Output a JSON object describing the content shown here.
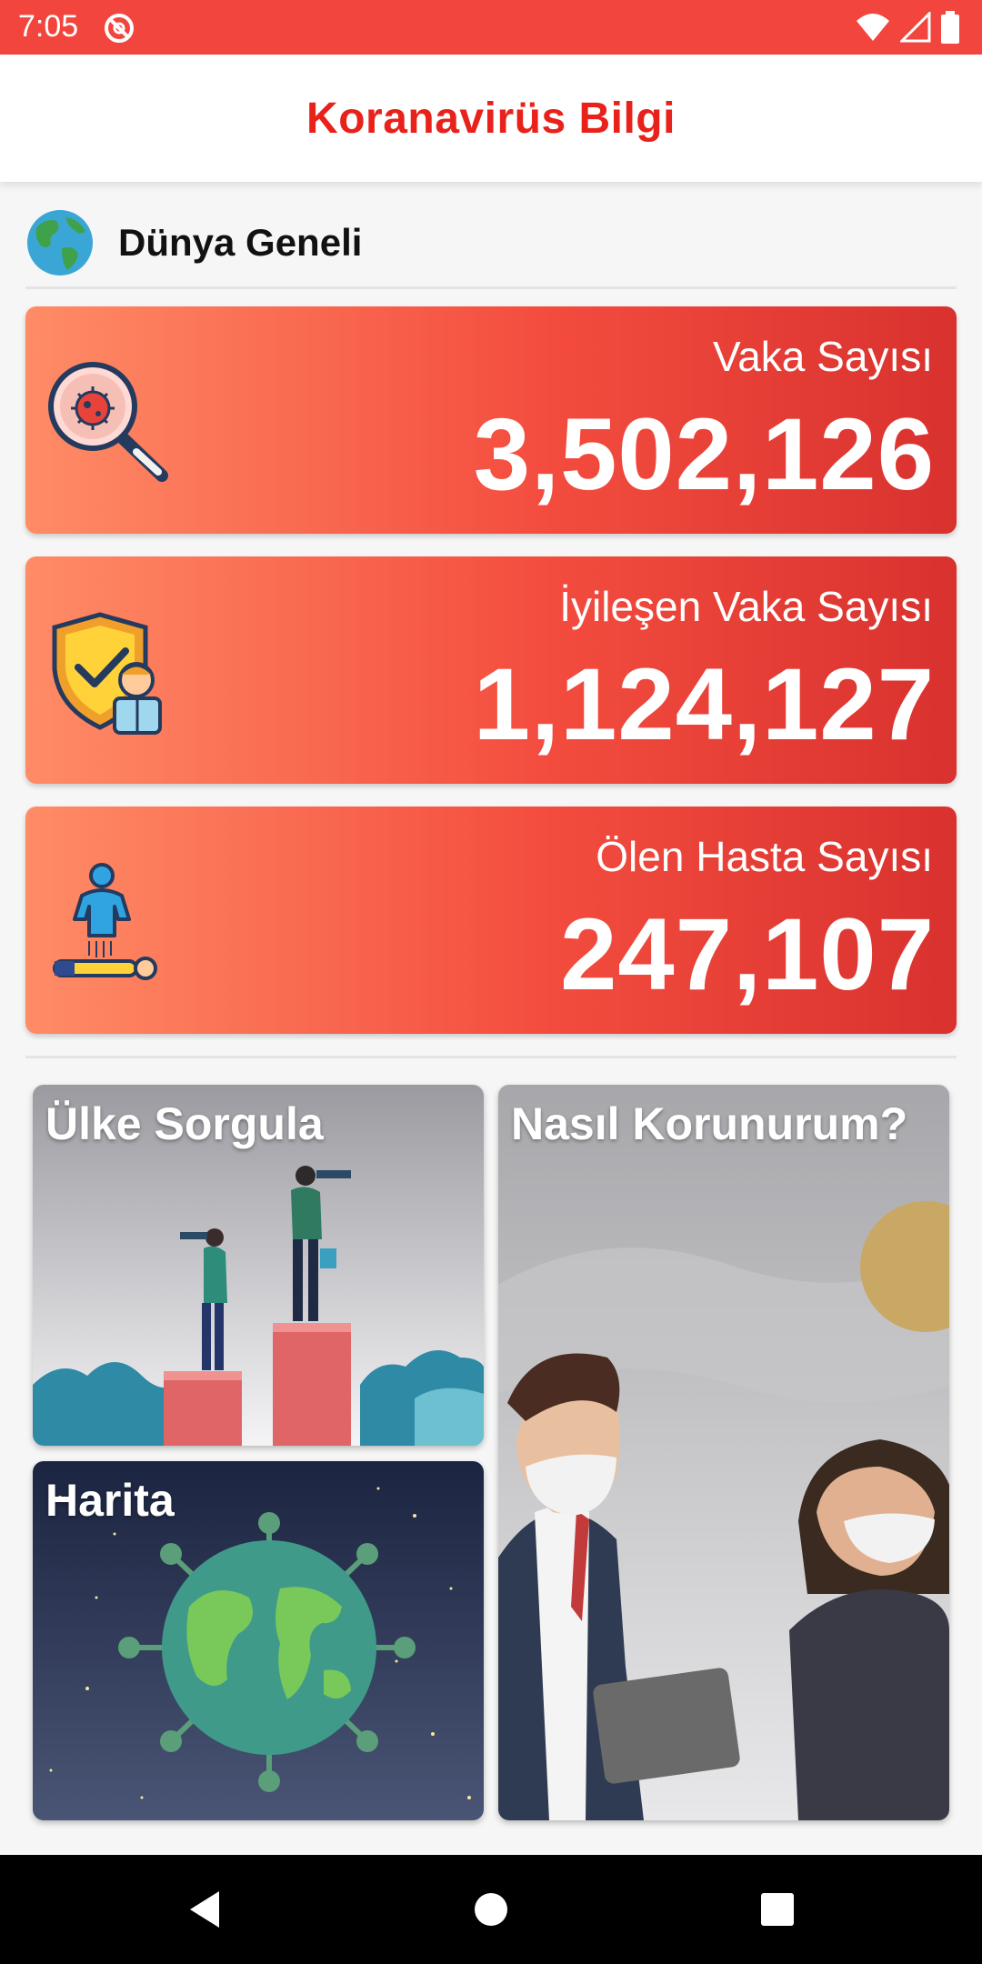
{
  "status_bar": {
    "time": "7:05"
  },
  "app_bar": {
    "title": "Koranavirüs Bilgi"
  },
  "world": {
    "heading": "Dünya Geneli"
  },
  "stats": [
    {
      "label": "Vaka Sayısı",
      "value": "3,502,126",
      "icon": "virus-search-icon"
    },
    {
      "label": "İyileşen Vaka Sayısı",
      "value": "1,124,127",
      "icon": "shield-person-icon"
    },
    {
      "label": "Ölen Hasta Sayısı",
      "value": "247,107",
      "icon": "deceased-person-icon"
    }
  ],
  "tiles": {
    "country_query": "Ülke Sorgula",
    "protection": "Nasıl Korunurum?",
    "map": "Harita"
  },
  "colors": {
    "accent": "#f2453d",
    "title_red": "#e8221b",
    "card_gradient_start": "#ff8c66",
    "card_gradient_end": "#d9312e"
  }
}
